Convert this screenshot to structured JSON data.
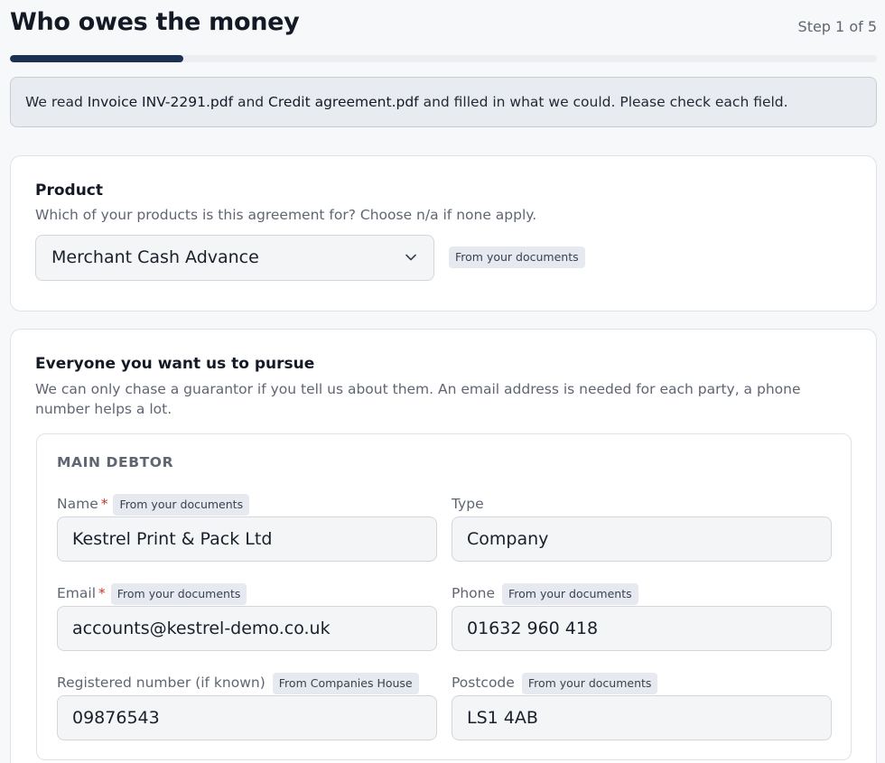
{
  "header": {
    "title": "Who owes the money",
    "step": "Step 1 of 5",
    "progress": 0.2
  },
  "notice": {
    "prefix": "We read ",
    "doc1": "Invoice INV-2291.pdf",
    "middle": " and ",
    "doc2": "Credit agreement.pdf",
    "suffix": " and filled in what we could. Please check each field."
  },
  "product": {
    "title": "Product",
    "description": "Which of your products is this agreement for? Choose n/a if none apply.",
    "selected": "Merchant Cash Advance",
    "source_tag": "From your documents"
  },
  "parties": {
    "title": "Everyone you want us to pursue",
    "description": "We can only chase a guarantor if you tell us about them. An email address is needed for each party, a phone number helps a lot.",
    "main_debtor": {
      "heading": "MAIN DEBTOR",
      "name": {
        "label": "Name",
        "required": "*",
        "tag": "From your documents",
        "value": "Kestrel Print & Pack Ltd"
      },
      "type": {
        "label": "Type",
        "value": "Company"
      },
      "email": {
        "label": "Email",
        "required": "*",
        "tag": "From your documents",
        "value": "accounts@kestrel-demo.co.uk"
      },
      "phone": {
        "label": "Phone",
        "tag": "From your documents",
        "value": "01632 960 418"
      },
      "registered_number": {
        "label": "Registered number (if known)",
        "tag": "From Companies House",
        "value": "09876543"
      },
      "postcode": {
        "label": "Postcode",
        "tag": "From your documents",
        "value": "LS1 4AB"
      }
    }
  },
  "colors": {
    "progress": "#1c3152",
    "required": "#c0392b",
    "tag_bg": "#e6e9ef"
  },
  "icons": {
    "select_chevron": "chevron-down-icon"
  }
}
